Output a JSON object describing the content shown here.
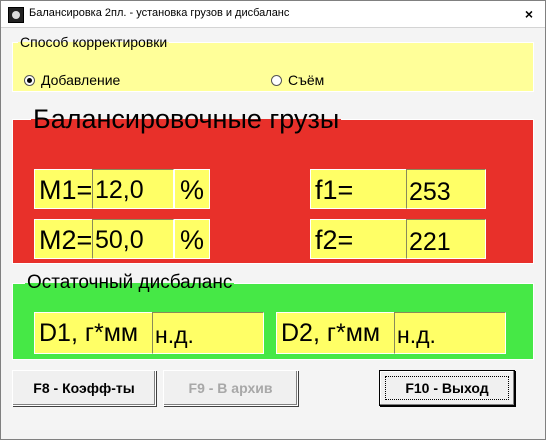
{
  "window": {
    "title": "Балансировка 2пл. - установка грузов и дисбаланс",
    "close_label": "×"
  },
  "method_group": {
    "legend": "Способ корректировки",
    "options": [
      {
        "label": "Добавление",
        "selected": true
      },
      {
        "label": "Съём",
        "selected": false
      }
    ]
  },
  "weights_group": {
    "legend": "Балансировочные грузы",
    "m1_label": "M1=",
    "m1_value": "12,0",
    "m1_unit": "%",
    "m2_label": "M2=",
    "m2_value": "50,0",
    "m2_unit": "%",
    "f1_label": "f1=",
    "f1_value": "253",
    "f2_label": "f2=",
    "f2_value": "221"
  },
  "residual_group": {
    "legend": "Остаточный дисбаланс",
    "d1_label": "D1, г*мм",
    "d1_value": "н.д.",
    "d2_label": "D2, г*мм",
    "d2_value": "н.д."
  },
  "buttons": {
    "coeffs": "F8 - Коэфф-ты",
    "archive": "F9 - В архив",
    "exit": "F10 - Выход"
  },
  "colors": {
    "method_bg": "#ffff99",
    "weights_bg": "#e8302a",
    "residual_bg": "#46e846",
    "field_bg": "#ffff66"
  }
}
